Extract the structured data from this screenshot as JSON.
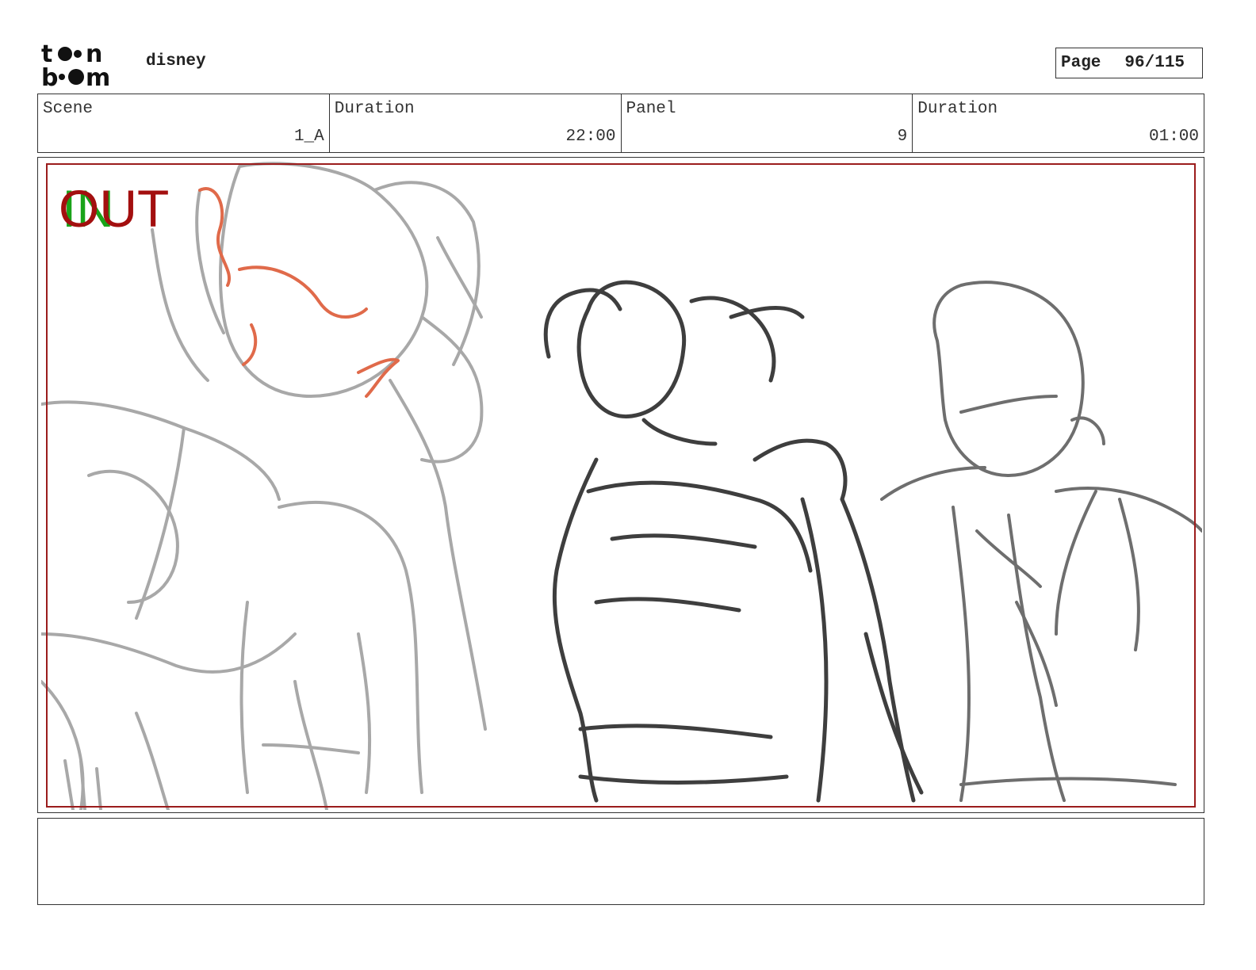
{
  "header": {
    "project_name": "disney",
    "page_label": "Page",
    "page_number": "96/115"
  },
  "info": {
    "scene_label": "Scene",
    "scene_value": "1_A",
    "scene_duration_label": "Duration",
    "scene_duration_value": "22:00",
    "panel_label": "Panel",
    "panel_value": "9",
    "panel_duration_label": "Duration",
    "panel_duration_value": "01:00"
  },
  "panel": {
    "in_marker": "IN",
    "out_marker": "OUT",
    "safe_frame_color": "#9b1c1c",
    "in_color": "#19a319",
    "out_color": "#a30f0f"
  },
  "notes": {
    "text": ""
  },
  "logo": {
    "icon": "toon-boom-logo",
    "text": "toon boom"
  }
}
